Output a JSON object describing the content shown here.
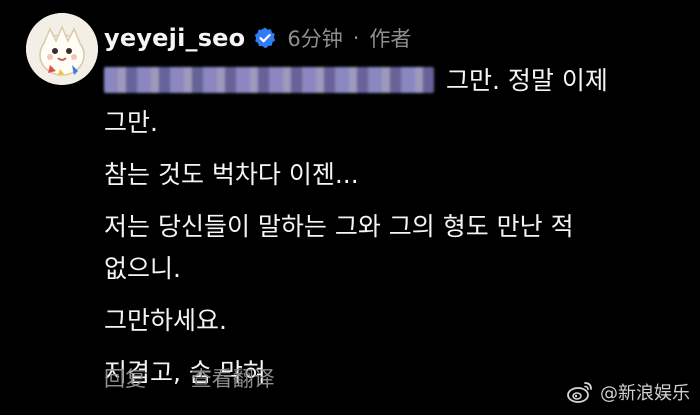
{
  "comment": {
    "username": "yeyeji_seo",
    "time": "6分钟",
    "separator": "·",
    "role": "作者",
    "lines": [
      "그만. 정말 이제",
      "그만.",
      "참는 것도 벅차다 이젠...",
      "저는 당신들이 말하는 그와 그의 형도 만난 적",
      "없으니.",
      "그만하세요.",
      "지겹고, 숨 막혀"
    ]
  },
  "actions": {
    "reply": "回复",
    "translate": "查看翻译"
  },
  "watermark": {
    "text": "@新浪娱乐"
  },
  "icons": {
    "avatar": "togepi-avatar",
    "verified": "verified-badge-icon",
    "weibo": "weibo-logo-icon"
  },
  "colors": {
    "background": "#000000",
    "text": "#f5f5f5",
    "muted": "#8e8e8e",
    "verified": "#2f7cf6"
  }
}
